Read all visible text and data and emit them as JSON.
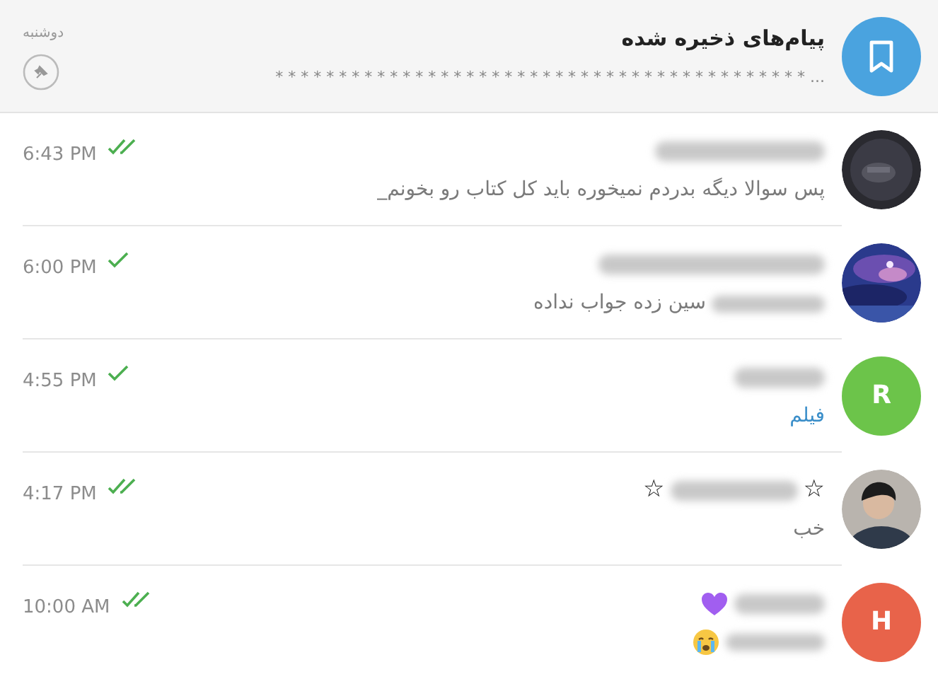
{
  "saved": {
    "title": "پیام‌های ذخیره شده",
    "date": "دوشنبه",
    "preview": "* * * * * * * * * * * * * * * * * * * * * * * * * * * * * * * * * * * * * * * * * * ...",
    "pinned": true
  },
  "chats": [
    {
      "avatar": {
        "kind": "picture"
      },
      "time": "6:43 PM",
      "read": true,
      "name_parts": [
        {
          "kind": "blurred"
        }
      ],
      "message_parts": [
        {
          "kind": "text",
          "text": "پس سوالا دیگه بدردم نمیخوره باید کل کتاب رو بخونم_"
        }
      ]
    },
    {
      "avatar": {
        "kind": "picture"
      },
      "time": "6:00 PM",
      "read": false,
      "name_parts": [
        {
          "kind": "blurred"
        }
      ],
      "message_parts": [
        {
          "kind": "blurred"
        },
        {
          "kind": "text",
          "text": "سین زده جواب نداده"
        }
      ]
    },
    {
      "avatar": {
        "kind": "letter",
        "letter": "R",
        "color": "#6cc44a"
      },
      "time": "4:55 PM",
      "read": false,
      "name_parts": [
        {
          "kind": "blurred"
        }
      ],
      "message_parts": [
        {
          "kind": "media",
          "text": "فیلم"
        }
      ]
    },
    {
      "avatar": {
        "kind": "picture"
      },
      "time": "4:17 PM",
      "read": true,
      "name_parts": [
        {
          "kind": "symbol",
          "text": "☆"
        },
        {
          "kind": "blurred"
        },
        {
          "kind": "symbol",
          "text": "☆"
        }
      ],
      "message_parts": [
        {
          "kind": "text",
          "text": "خب"
        }
      ]
    },
    {
      "avatar": {
        "kind": "letter",
        "letter": "H",
        "color": "#e8634a"
      },
      "time": "10:00 AM",
      "read": true,
      "name_parts": [
        {
          "kind": "blurred"
        },
        {
          "kind": "heart"
        }
      ],
      "message_parts": [
        {
          "kind": "blurred"
        },
        {
          "kind": "emoji"
        }
      ]
    }
  ]
}
